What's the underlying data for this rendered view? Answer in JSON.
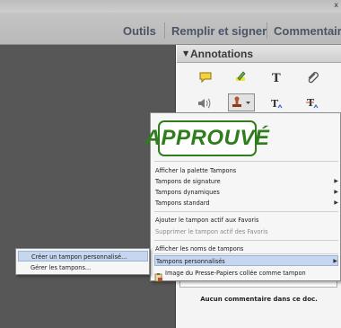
{
  "toolbar": {
    "tabs": [
      "Outils",
      "Remplir et signer",
      "Commentaire"
    ]
  },
  "panel": {
    "title": "Annotations",
    "empty_text": "Aucun commentaire dans ce doc."
  },
  "context_menu": {
    "stamp_label": "APPROUVÉ",
    "items": [
      "Afficher la palette Tampons",
      "Tampons de signature",
      "Tampons dynamiques",
      "Tampons standard",
      "Ajouter le tampon actif aux Favoris",
      "Supprimer le tampon actif des Favoris",
      "Afficher les noms de tampons",
      "Tampons personnalisés",
      "Image du Presse-Papiers collée comme tampon"
    ]
  },
  "submenu": {
    "items": [
      "Créer un tampon personnalisé...",
      "Gérer les tampons..."
    ]
  },
  "colors": {
    "stamp_green": "#2f7d1c",
    "highlight": "#c6d6ee",
    "doc_background": "#575757"
  }
}
